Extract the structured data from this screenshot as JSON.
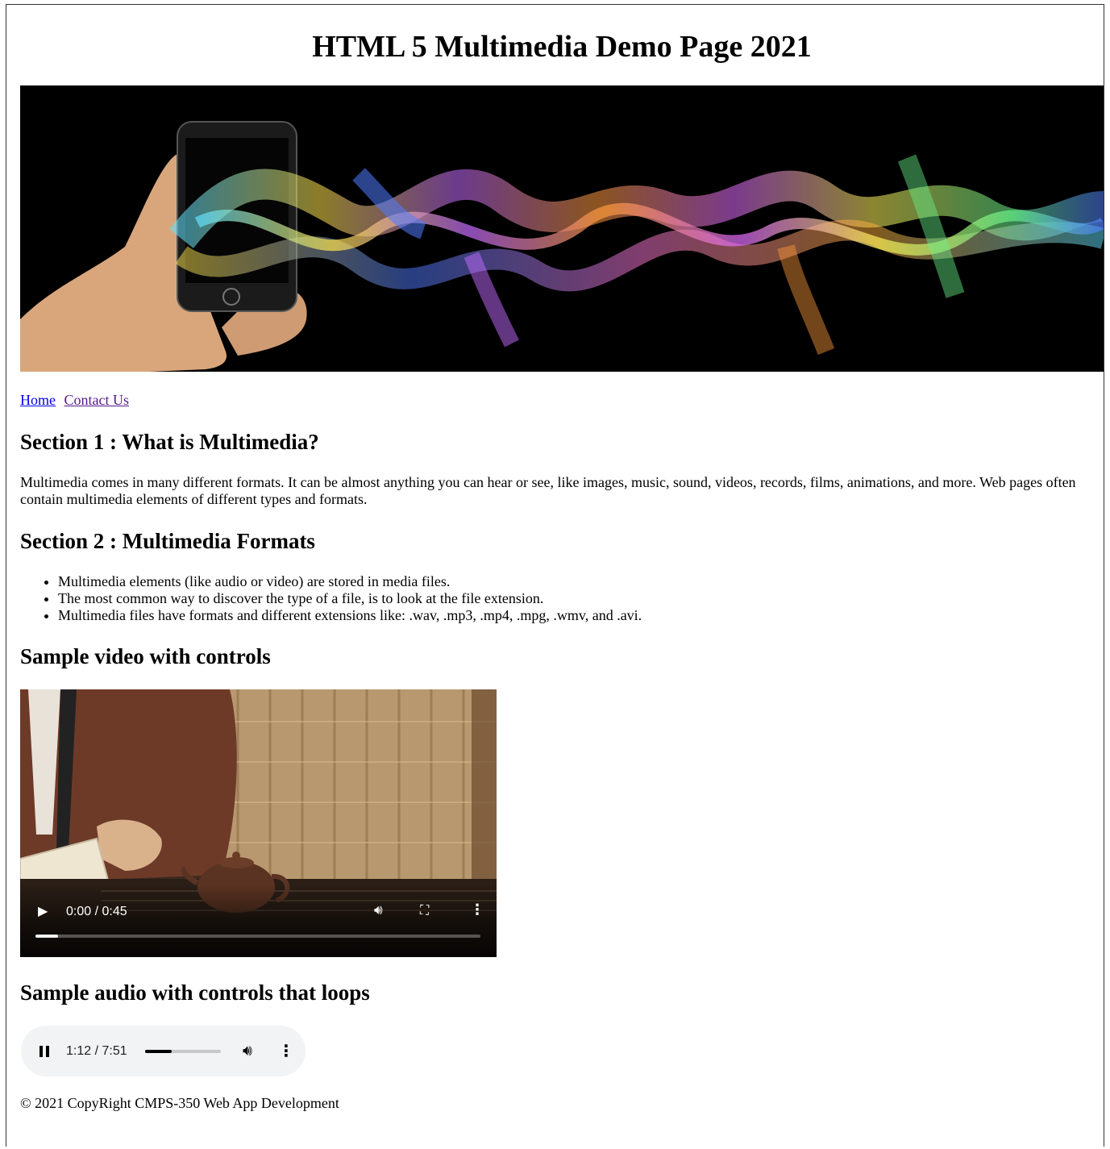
{
  "page": {
    "title": "HTML 5 Multimedia Demo Page 2021"
  },
  "nav": {
    "home": "Home",
    "contact": "Contact Us"
  },
  "section1": {
    "heading": "Section 1 : What is Multimedia?",
    "body": "Multimedia comes in many different formats. It can be almost anything you can hear or see, like images, music, sound, videos, records, films, animations, and more. Web pages often contain multimedia elements of different types and formats."
  },
  "section2": {
    "heading": "Section 2 : Multimedia Formats",
    "items": [
      "Multimedia elements (like audio or video) are stored in media files.",
      "The most common way to discover the type of a file, is to look at the file extension.",
      "Multimedia files have formats and different extensions like: .wav, .mp3, .mp4, .mpg, .wmv, and .avi."
    ]
  },
  "video_section": {
    "heading": "Sample video with controls",
    "time": "0:00 / 0:45",
    "progress": 0.05,
    "state": "paused"
  },
  "audio_section": {
    "heading": "Sample audio with controls that loops",
    "time": "1:12 / 7:51",
    "progress": 0.35,
    "state": "playing"
  },
  "footer": {
    "text": "© 2021 CopyRight CMPS-350 Web App Development"
  },
  "colors": {
    "link": "#0000ee",
    "visited_link": "#551a8b",
    "audio_bg": "#f1f3f4"
  }
}
